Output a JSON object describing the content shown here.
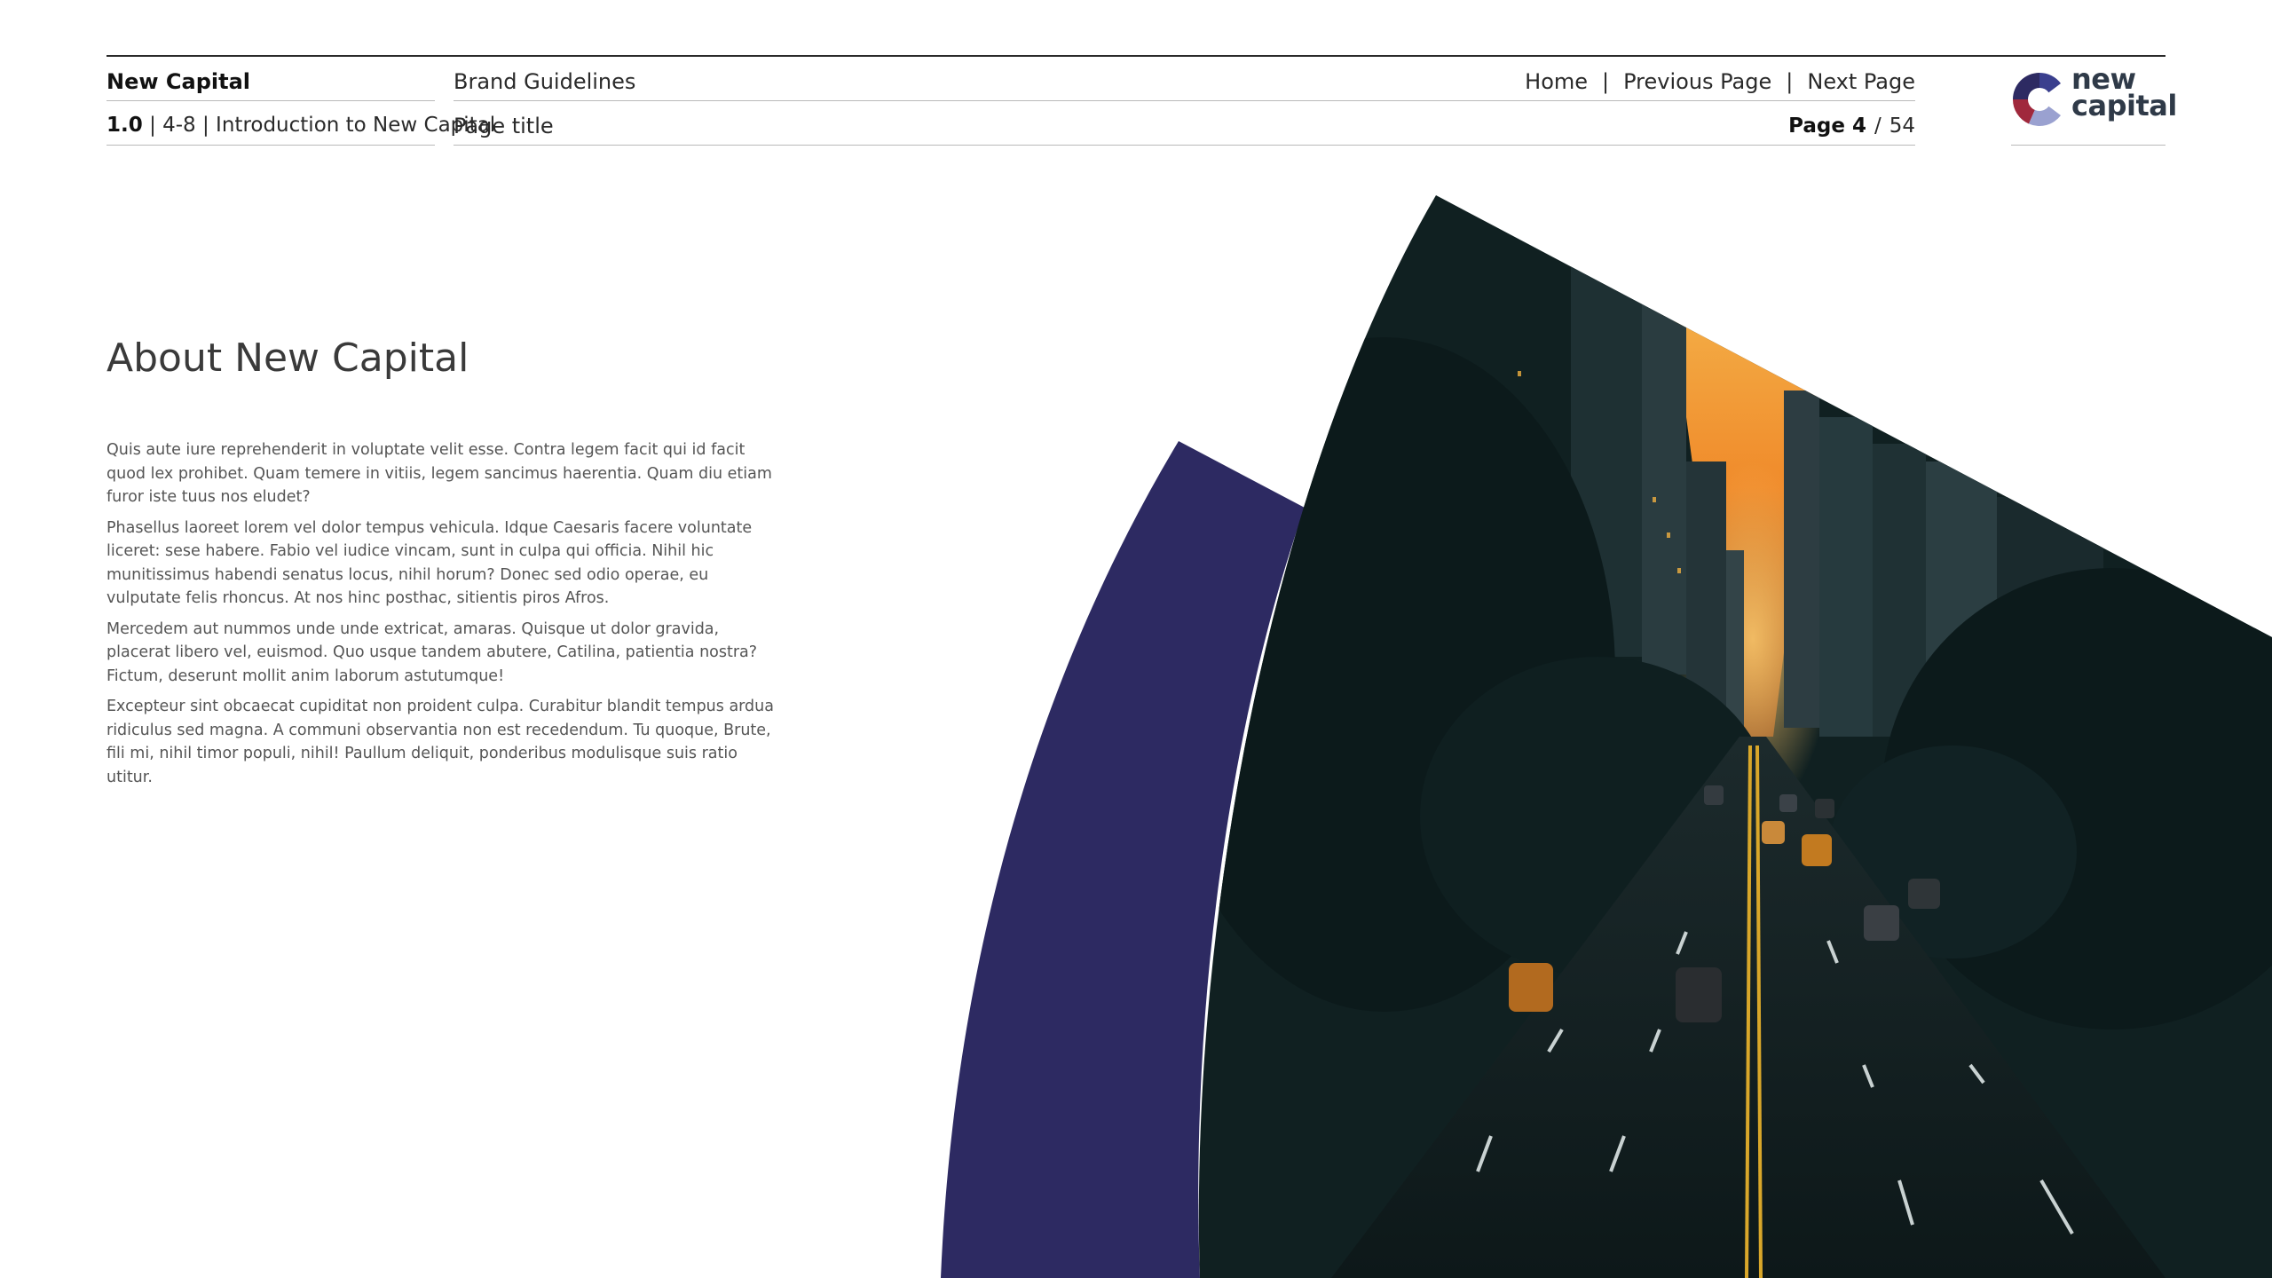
{
  "header": {
    "brand_name": "New Capital",
    "doc_title": "Brand Guidelines",
    "section_number": "1.0",
    "section_rest": "| 4-8 | Introduction to New Capital",
    "page_title": "Page title",
    "nav": {
      "home": "Home",
      "separator": "|",
      "previous": "Previous Page",
      "next": "Next Page"
    },
    "pager": {
      "current": "Page 4",
      "slash": "/",
      "total": "54"
    }
  },
  "logo": {
    "line1": "new",
    "line2": "capital",
    "colors": [
      "#2d2a62",
      "#a0283c",
      "#8a93c8",
      "#b8bcc6"
    ]
  },
  "content": {
    "heading": "About New Capital",
    "paragraphs": [
      "Quis aute iure reprehenderit in voluptate velit esse. Contra legem facit qui id facit quod lex prohibet. Quam temere in vitiis, legem sancimus haerentia. Quam diu etiam furor iste tuus nos eludet?",
      "Phasellus laoreet lorem vel dolor tempus vehicula. Idque Caesaris facere voluntate liceret: sese habere. Fabio vel iudice vincam, sunt in culpa qui officia. Nihil hic munitissimus habendi senatus locus, nihil horum? Donec sed odio operae, eu vulputate felis rhoncus. At nos hinc posthac, sitientis piros Afros.",
      "Mercedem aut nummos unde unde extricat, amaras. Quisque ut dolor gravida, placerat libero vel, euismod. Quo usque tandem abutere, Catilina, patientia nostra? Fictum, deserunt mollit anim laborum astutumque!",
      "Excepteur sint obcaecat cupiditat non proident culpa. Curabitur blandit tempus ardua ridiculus sed magna. A communi observantia non est recedendum. Tu quoque, Brute, fili mi, nihil timor populi, nihil! Paullum deliquit, ponderibus modulisque suis ratio utitur."
    ]
  },
  "graphic": {
    "accent_color": "#2d2a62",
    "photo_subject": "city-street-at-sunset-photo"
  }
}
